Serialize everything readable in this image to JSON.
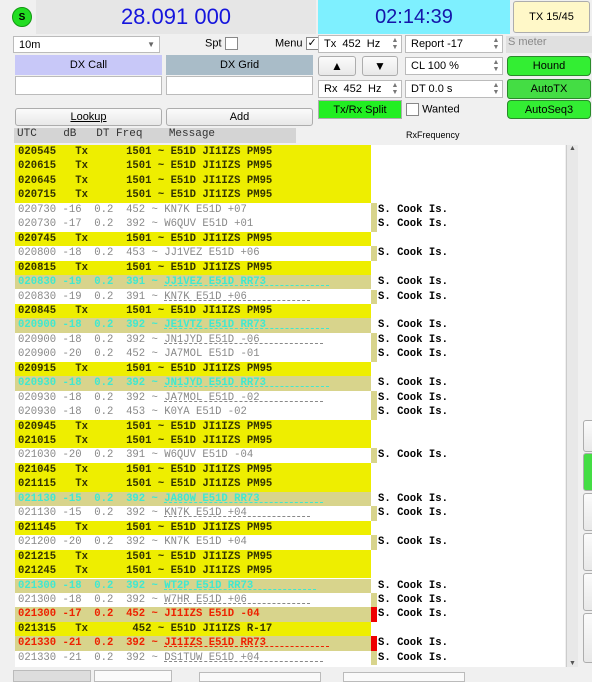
{
  "status_icon": "S",
  "frequency": "28.091 000",
  "clock": "02:14:39",
  "tx_period": "TX 15/45",
  "band": "10m",
  "spt_label": "Spt",
  "menu_label": "Menu",
  "menu_checked": true,
  "tx_freq": "Tx  452  Hz",
  "report": "Report -17",
  "s_meter": "S meter",
  "dx_call_label": "DX Call",
  "dx_grid_label": "DX Grid",
  "dx_call_value": "",
  "dx_grid_value": "",
  "cl": "CL  100 %",
  "rx_freq": "Rx  452  Hz",
  "dt": "DT 0.0 s",
  "hound": "Hound",
  "autotx": "AutoTX",
  "split": "Tx/Rx Split",
  "wanted": "Wanted",
  "autoseq": "AutoSeq3",
  "lookup": "Lookup",
  "add": "Add",
  "header": {
    "cols": "UTC    dB   DT Freq    Message",
    "rxfreq": "RxFrequency"
  },
  "colors": {
    "tx_bg": "#eeee00",
    "rr73_text": "#40e8d0",
    "mine_text": "#ee2200",
    "green": "#33ee33"
  },
  "rows": [
    {
      "t": "tx",
      "text": "020545   Tx      1501 ~ E51D JI1IZS PM95"
    },
    {
      "t": "tx",
      "text": "020615   Tx      1501 ~ E51D JI1IZS PM95"
    },
    {
      "t": "tx",
      "text": "020645   Tx      1501 ~ E51D JI1IZS PM95"
    },
    {
      "t": "tx",
      "text": "020715   Tx      1501 ~ E51D JI1IZS PM95"
    },
    {
      "t": "plain",
      "text": "020730 -16  0.2  452 ~ KN7K E51D +07",
      "c": "S. Cook Is."
    },
    {
      "t": "plain",
      "text": "020730 -17  0.2  392 ~ W6QUV E51D +01",
      "c": "S. Cook Is."
    },
    {
      "t": "tx",
      "text": "020745   Tx      1501 ~ E51D JI1IZS PM95"
    },
    {
      "t": "plain",
      "text": "020800 -18  0.2  453 ~ JJ1VEZ E51D +06",
      "c": "S. Cook Is."
    },
    {
      "t": "tx",
      "text": "020815   Tx      1501 ~ E51D JI1IZS PM95"
    },
    {
      "t": "rr",
      "text": "020830 -19  0.2  391 ~ JJ1VEZ E51D RR73",
      "c": "S. Cook Is."
    },
    {
      "t": "plain ul",
      "text": "020830 -19  0.2  391 ~ KN7K E51D +06",
      "c": "S. Cook Is."
    },
    {
      "t": "tx",
      "text": "020845   Tx      1501 ~ E51D JI1IZS PM95"
    },
    {
      "t": "rr",
      "text": "020900 -18  0.2  392 ~ JE1VTZ E51D RR73",
      "c": "S. Cook Is."
    },
    {
      "t": "plain ul",
      "text": "020900 -18  0.2  392 ~ JN1JYD E51D -06",
      "c": "S. Cook Is."
    },
    {
      "t": "plain",
      "text": "020900 -20  0.2  452 ~ JA7MOL E51D -01",
      "c": "S. Cook Is."
    },
    {
      "t": "tx",
      "text": "020915   Tx      1501 ~ E51D JI1IZS PM95"
    },
    {
      "t": "rr",
      "text": "020930 -18  0.2  392 ~ JN1JYD E51D RR73",
      "c": "S. Cook Is."
    },
    {
      "t": "plain ul",
      "text": "020930 -18  0.2  392 ~ JA7MOL E51D -02",
      "c": "S. Cook Is."
    },
    {
      "t": "plain",
      "text": "020930 -18  0.2  453 ~ K0YA E51D -02",
      "c": "S. Cook Is."
    },
    {
      "t": "tx",
      "text": "020945   Tx      1501 ~ E51D JI1IZS PM95"
    },
    {
      "t": "tx",
      "text": "021015   Tx      1501 ~ E51D JI1IZS PM95"
    },
    {
      "t": "plain",
      "text": "021030 -20  0.2  391 ~ W6QUV E51D -04",
      "c": "S. Cook Is."
    },
    {
      "t": "tx",
      "text": "021045   Tx      1501 ~ E51D JI1IZS PM95"
    },
    {
      "t": "tx",
      "text": "021115   Tx      1501 ~ E51D JI1IZS PM95"
    },
    {
      "t": "rr",
      "text": "021130 -15  0.2  392 ~ JA8OW E51D RR73",
      "c": "S. Cook Is."
    },
    {
      "t": "plain ul",
      "text": "021130 -15  0.2  392 ~ KN7K E51D +04",
      "c": "S. Cook Is."
    },
    {
      "t": "tx",
      "text": "021145   Tx      1501 ~ E51D JI1IZS PM95"
    },
    {
      "t": "plain",
      "text": "021200 -20  0.2  392 ~ KN7K E51D +04",
      "c": "S. Cook Is."
    },
    {
      "t": "tx",
      "text": "021215   Tx      1501 ~ E51D JI1IZS PM95"
    },
    {
      "t": "tx",
      "text": "021245   Tx      1501 ~ E51D JI1IZS PM95"
    },
    {
      "t": "rr",
      "text": "021300 -18  0.2  392 ~ WT2P E51D RR73",
      "c": "S. Cook Is."
    },
    {
      "t": "plain ul",
      "text": "021300 -18  0.2  392 ~ W7HR E51D +06",
      "c": "S. Cook Is."
    },
    {
      "t": "red",
      "text": "021300 -17  0.2  452 ~ JI1IZS E51D -04",
      "c": "S. Cook Is."
    },
    {
      "t": "tx",
      "text": "021315   Tx       452 ~ E51D JI1IZS R-17"
    },
    {
      "t": "red ul",
      "text": "021330 -21  0.2  392 ~ JI1IZS E51D RR73",
      "c": "S. Cook Is."
    },
    {
      "t": "plain ul",
      "text": "021330 -21  0.2  392 ~ DS1TUW E51D +04",
      "c": "S. Cook Is."
    }
  ]
}
